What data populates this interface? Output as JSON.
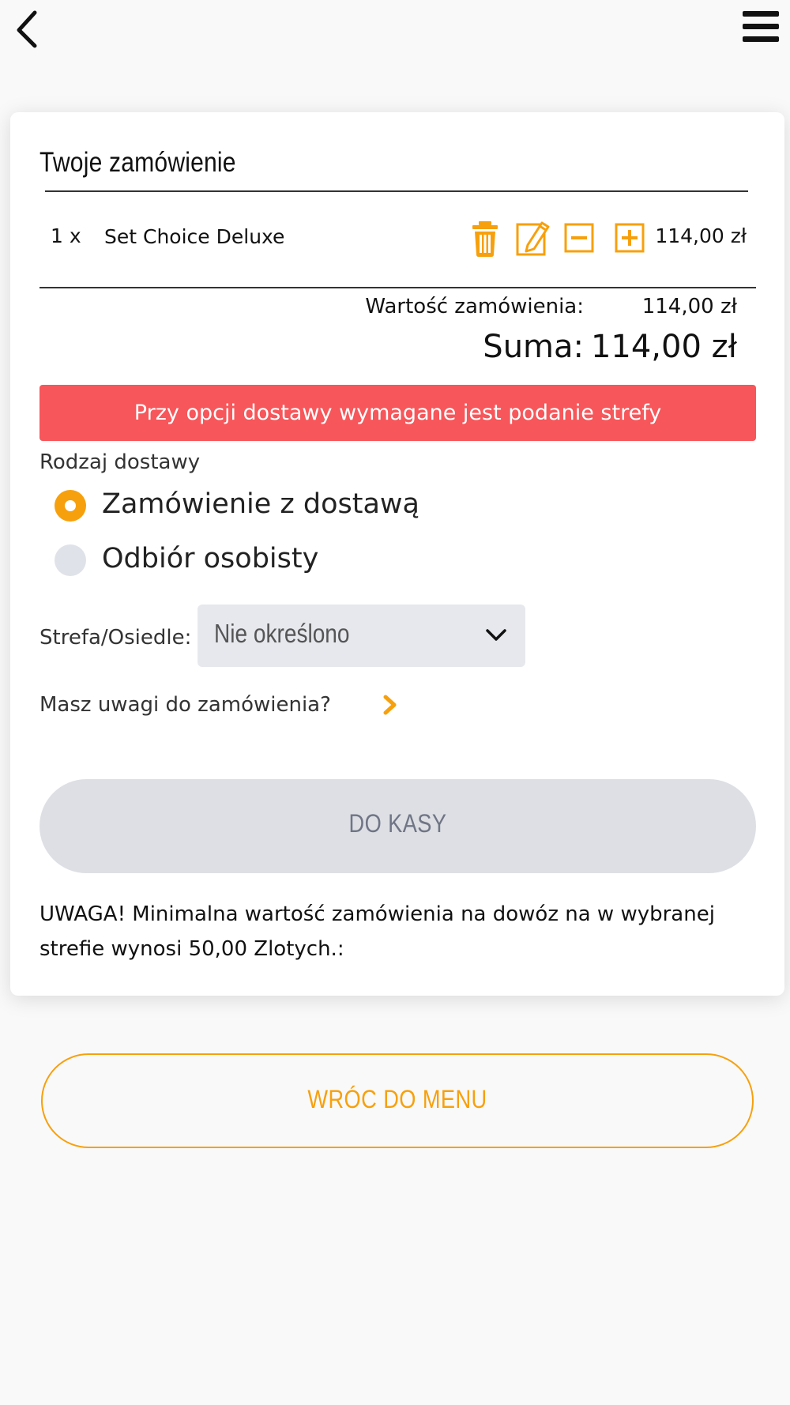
{
  "header": {
    "back_icon": "chevron-left-icon",
    "menu_icon": "hamburger-menu-icon"
  },
  "order": {
    "title": "Twoje zamówienie",
    "items": [
      {
        "qty": "1 x",
        "name": "Set Choice Deluxe",
        "price": "114,00 zł",
        "icons": [
          "trash-icon",
          "edit-icon",
          "minus-icon",
          "plus-icon"
        ]
      }
    ],
    "subtotal_label": "Wartość zamówienia:",
    "subtotal_value": "114,00 zł",
    "total_label": "Suma:",
    "total_value": "114,00 zł"
  },
  "alert": {
    "text": "Przy opcji dostawy wymagane jest podanie strefy",
    "color": "#f7565a"
  },
  "delivery": {
    "label": "Rodzaj dostawy",
    "options": [
      {
        "label": "Zamówienie z dostawą",
        "selected": true
      },
      {
        "label": "Odbiór osobisty",
        "selected": false
      }
    ]
  },
  "zone": {
    "label": "Strefa/Osiedle:",
    "selected_value": "Nie określono"
  },
  "notes": {
    "label": "Masz uwagi do zamówienia?"
  },
  "checkout": {
    "label": "DO KASY"
  },
  "warning": {
    "text": "UWAGA! Minimalna wartość zamówienia na dowóz na w wybranej strefie wynosi 50,00 Zlotych.:"
  },
  "back_to_menu": {
    "label": "WRÓC DO MENU"
  },
  "colors": {
    "accent": "#f7a00d",
    "error": "#f7565a",
    "disabled_button": "#dddfe4",
    "background": "#f9f9f9"
  }
}
